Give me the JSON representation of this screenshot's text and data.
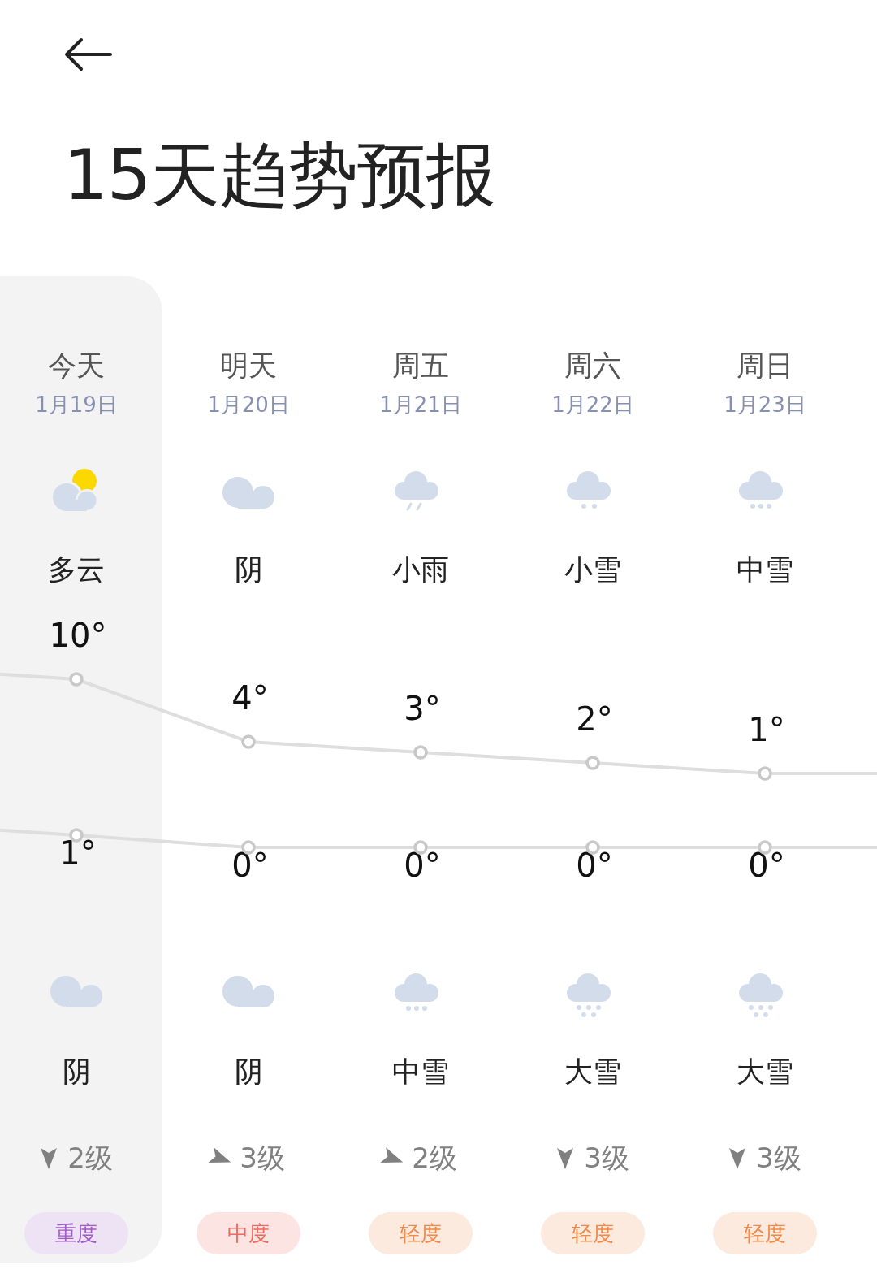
{
  "title": "15天趋势预报",
  "days": [
    {
      "day": "今天",
      "date": "1月19日",
      "selected": true,
      "day_weather": {
        "kind": "partly_cloudy",
        "text": "多云"
      },
      "high": "10°",
      "low": "1°",
      "night_weather": {
        "kind": "overcast",
        "text": "阴"
      },
      "wind": {
        "kind": "down",
        "text": "2级"
      },
      "air": {
        "text": "重度",
        "color": "#a05cc8"
      }
    },
    {
      "day": "明天",
      "date": "1月20日",
      "selected": false,
      "day_weather": {
        "kind": "overcast",
        "text": "阴"
      },
      "high": "4°",
      "low": "0°",
      "night_weather": {
        "kind": "overcast",
        "text": "阴"
      },
      "wind": {
        "kind": "right",
        "text": "3级"
      },
      "air": {
        "text": "中度",
        "color": "#ee6a5e"
      }
    },
    {
      "day": "周五",
      "date": "1月21日",
      "selected": false,
      "day_weather": {
        "kind": "light_rain",
        "text": "小雨"
      },
      "high": "3°",
      "low": "0°",
      "night_weather": {
        "kind": "moderate_snow",
        "text": "中雪"
      },
      "wind": {
        "kind": "right",
        "text": "2级"
      },
      "air": {
        "text": "轻度",
        "color": "#f08a4b"
      }
    },
    {
      "day": "周六",
      "date": "1月22日",
      "selected": false,
      "day_weather": {
        "kind": "light_snow",
        "text": "小雪"
      },
      "high": "2°",
      "low": "0°",
      "night_weather": {
        "kind": "heavy_snow",
        "text": "大雪"
      },
      "wind": {
        "kind": "down",
        "text": "3级"
      },
      "air": {
        "text": "轻度",
        "color": "#f08a4b"
      }
    },
    {
      "day": "周日",
      "date": "1月23日",
      "selected": false,
      "day_weather": {
        "kind": "moderate_snow",
        "text": "中雪"
      },
      "high": "1°",
      "low": "0°",
      "night_weather": {
        "kind": "heavy_snow",
        "text": "大雪"
      },
      "wind": {
        "kind": "down",
        "text": "3级"
      },
      "air": {
        "text": "轻度",
        "color": "#f08a4b"
      }
    }
  ]
}
